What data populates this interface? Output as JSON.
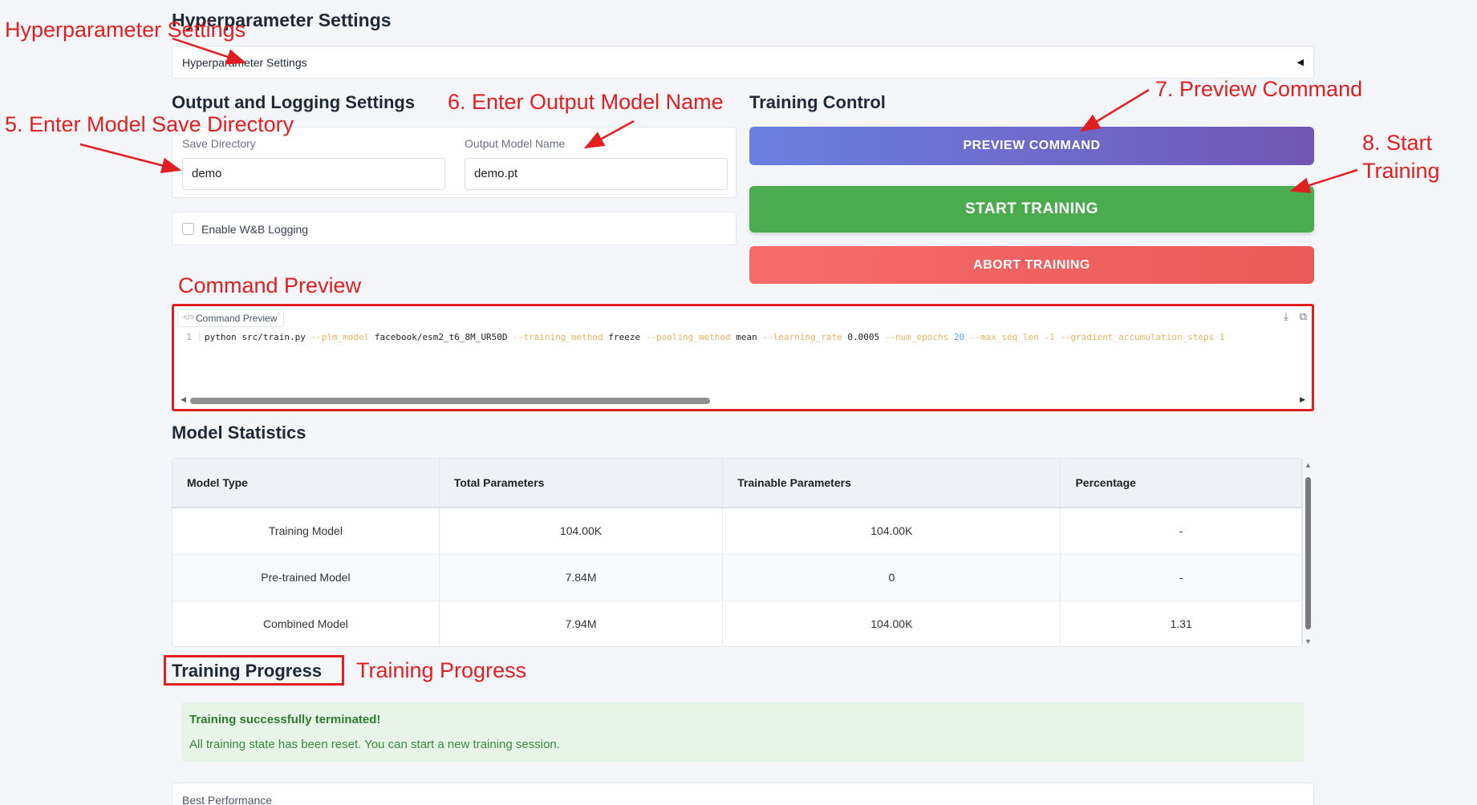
{
  "hyperparameter": {
    "heading": "Hyperparameter Settings",
    "accordion_label": "Hyperparameter Settings",
    "accordion_caret": "◀"
  },
  "output": {
    "heading": "Output and Logging Settings",
    "save_dir_label": "Save Directory",
    "save_dir_value": "demo",
    "model_name_label": "Output Model Name",
    "model_name_value": "demo.pt",
    "wandb_label": "Enable W&B Logging",
    "wandb_checked": false
  },
  "training_control": {
    "heading": "Training Control",
    "preview_button": "PREVIEW COMMAND",
    "start_button": "START TRAINING",
    "abort_button": "ABORT TRAINING"
  },
  "command_preview": {
    "tab_label": "Command Preview",
    "line_number": "1",
    "tokens": [
      {
        "t": "python src/train.py ",
        "c": "plain"
      },
      {
        "t": "--plm_model ",
        "c": "flag"
      },
      {
        "t": "facebook/esm2_t6_8M_UR50D ",
        "c": "plain"
      },
      {
        "t": "--training_method ",
        "c": "flag"
      },
      {
        "t": "freeze ",
        "c": "plain"
      },
      {
        "t": "--pooling_method ",
        "c": "flag"
      },
      {
        "t": "mean ",
        "c": "plain"
      },
      {
        "t": "--learning_rate ",
        "c": "flag"
      },
      {
        "t": "0.0005 ",
        "c": "plain"
      },
      {
        "t": "--num_epochs ",
        "c": "flag"
      },
      {
        "t": "20 ",
        "c": "num"
      },
      {
        "t": "--max_seq_len ",
        "c": "flag"
      },
      {
        "t": "-1 ",
        "c": "flag"
      },
      {
        "t": "--gradient_accumulation_steps ",
        "c": "flag"
      },
      {
        "t": "1",
        "c": "flag"
      }
    ]
  },
  "model_statistics": {
    "heading": "Model Statistics",
    "columns": [
      "Model Type",
      "Total Parameters",
      "Trainable Parameters",
      "Percentage"
    ],
    "rows": [
      [
        "Training Model",
        "104.00K",
        "104.00K",
        "-"
      ],
      [
        "Pre-trained Model",
        "7.84M",
        "0",
        "-"
      ],
      [
        "Combined Model",
        "7.94M",
        "104.00K",
        "1.31"
      ]
    ]
  },
  "training_progress": {
    "heading": "Training Progress",
    "status_title": "Training successfully terminated!",
    "status_message": "All training state has been reset. You can start a new training session.",
    "best_performance_label": "Best Performance"
  },
  "annotations": {
    "hyperparameter": "Hyperparameter Settings",
    "save_dir": "5. Enter Model Save Directory",
    "model_name": "6. Enter Output Model Name",
    "preview": "7. Preview Command",
    "start_line1": "8. Start",
    "start_line2": "Training",
    "command_preview": "Command Preview",
    "training_progress": "Training Progress",
    "color": "#e02020"
  }
}
